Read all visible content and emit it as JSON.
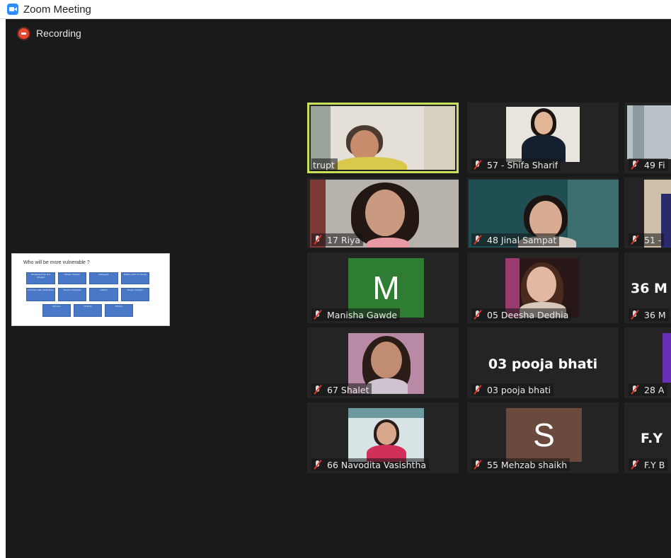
{
  "window": {
    "title": "Zoom Meeting"
  },
  "recording": {
    "label": "Recording"
  },
  "shared_screen": {
    "title": "Who will be more vulnerable ?",
    "boxes": [
      "Students from the villages",
      "Street children",
      "Refugees",
      "Elderly with no family",
      "Children with disabilities",
      "Trans individuals",
      "LGBTQ",
      "Single mothers",
      "Women",
      "Children",
      "Elderly",
      "Migrant workers",
      "Refugees of a war zone"
    ]
  },
  "participants": {
    "trupt": "trupt",
    "shifa": "57 - Shifa Sharif",
    "col3_r1": "49 Fi",
    "riya": "17 Riya",
    "jinal": "48 Jinal Sampat",
    "col3_r2": "51 -",
    "manisha": "Manisha Gawde",
    "manisha_initial": "M",
    "deesha": "05 Deesha Dedhia",
    "col3_r3": "36 M",
    "col3_r3_big": "36 M",
    "shalet": "67 Shalet",
    "pooja": "03 pooja bhati",
    "pooja_big": "03 pooja bhati",
    "col3_r4": "28 A",
    "navodita": "66 Navodita Vasishtha",
    "mehzab": "55 Mehzab shaikh",
    "mehzab_initial": "S",
    "col3_r5": "F.Y B",
    "col3_r5_big": "F.Y"
  },
  "colors": {
    "active_speaker_border": "#c8e05a",
    "recording_dot": "#e8462e",
    "meeting_bg": "#1a1a1a",
    "tile_bg": "#242424",
    "avatar_green": "#2f7d32",
    "avatar_brown": "#6a4a3c"
  },
  "icons": [
    "zoom-app-icon",
    "recording-icon",
    "mic-muted-icon"
  ]
}
